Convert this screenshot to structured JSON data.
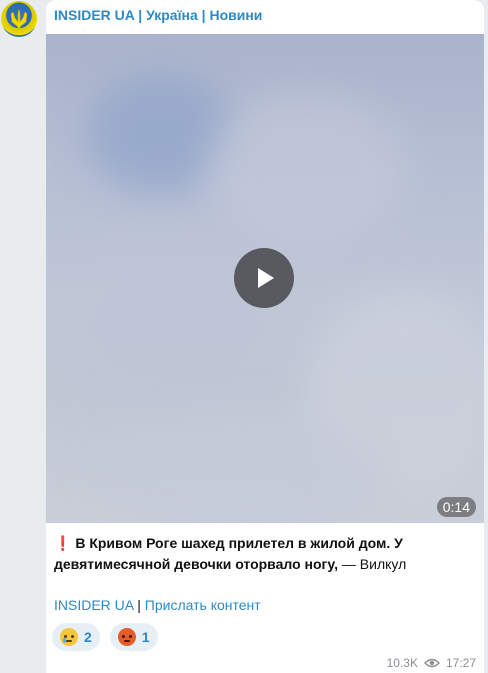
{
  "post": {
    "channel_name": "INSIDER UA | Україна | Новини",
    "video": {
      "duration": "0:14"
    },
    "text_bold": "В Кривом Роге шахед прилетел в жилой дом. У девятимесячной девочки оторвало ногу,",
    "text_tail": " — Вилкул",
    "excl_icon": "❗",
    "link_insider": "INSIDER UA",
    "separator": " | ",
    "link_submit": "Прислать контент",
    "reactions": [
      {
        "emoji": "crying-face",
        "count": "2"
      },
      {
        "emoji": "angry-face",
        "count": "1"
      }
    ],
    "views": "10.3K",
    "time": "17:27"
  },
  "colors": {
    "link": "#2c89c7",
    "reaction_bg": "#e6eef6"
  }
}
